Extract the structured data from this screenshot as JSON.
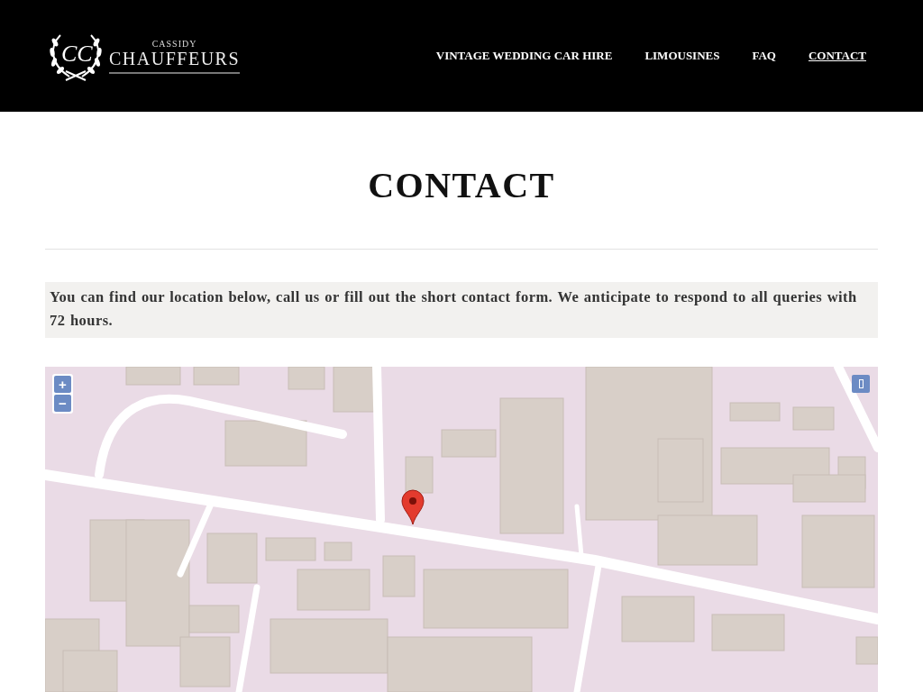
{
  "logo": {
    "monogram": "CC",
    "small": "CASSIDY",
    "name": "CHAUFFEURS"
  },
  "nav": [
    {
      "label": "VINTAGE WEDDING CAR HIRE",
      "selected": false
    },
    {
      "label": "LIMOUSINES",
      "selected": false
    },
    {
      "label": "FAQ",
      "selected": false
    },
    {
      "label": "CONTACT",
      "selected": true
    }
  ],
  "page_title": "CONTACT",
  "intro": "You can find our location below, call us or fill out the short contact form. We anticipate to respond to all queries with 72 hours.",
  "map": {
    "zoom_in": "+",
    "zoom_out": "−"
  }
}
